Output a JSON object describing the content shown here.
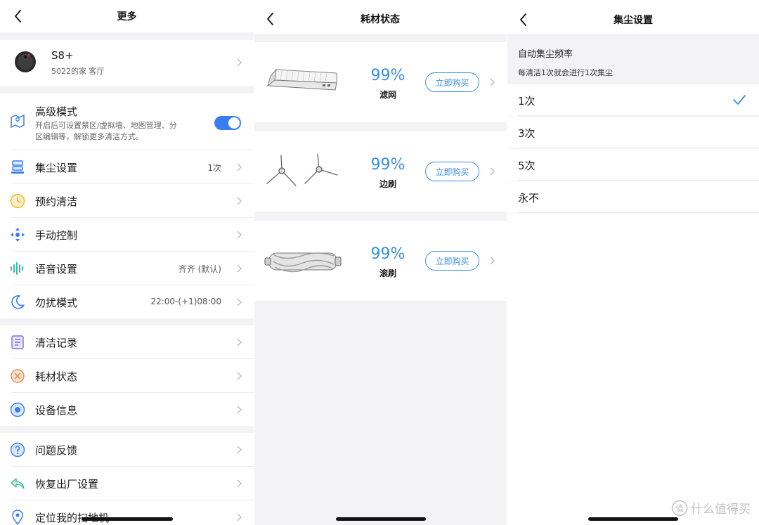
{
  "panel_more": {
    "title": "更多",
    "device": {
      "name": "S8+",
      "location": "5022的家 客厅"
    },
    "advanced_mode": {
      "label": "高级模式",
      "desc_line1": "开启后可设置禁区/虚拟墙、地图管理、分",
      "desc_line2": "区编辑等，解锁更多清洁方式。",
      "enabled": true
    },
    "items": [
      {
        "label": "集尘设置",
        "value": "1次",
        "icon": "dust-station-icon"
      },
      {
        "label": "预约清洁",
        "value": "",
        "icon": "clock-icon"
      },
      {
        "label": "手动控制",
        "value": "",
        "icon": "direction-pad-icon"
      },
      {
        "label": "语音设置",
        "value": "齐齐 (默认)",
        "icon": "sound-wave-icon"
      },
      {
        "label": "勿扰模式",
        "value": "22:00-(+1)08:00",
        "icon": "moon-icon"
      }
    ],
    "items2": [
      {
        "label": "清洁记录",
        "icon": "document-icon"
      },
      {
        "label": "耗材状态",
        "icon": "consumables-icon"
      },
      {
        "label": "设备信息",
        "icon": "device-info-icon"
      }
    ],
    "items3": [
      {
        "label": "问题反馈",
        "icon": "question-icon"
      },
      {
        "label": "恢复出厂设置",
        "icon": "reset-arrow-icon"
      },
      {
        "label": "定位我的扫地机",
        "icon": "location-pin-icon"
      }
    ]
  },
  "panel_consumables": {
    "title": "耗材状态",
    "items": [
      {
        "percent": "99%",
        "name": "滤网",
        "buy_label": "立即购买",
        "icon": "filter-icon"
      },
      {
        "percent": "99%",
        "name": "边刷",
        "buy_label": "立即购买",
        "icon": "side-brush-icon"
      },
      {
        "percent": "99%",
        "name": "滚刷",
        "buy_label": "立即购买",
        "icon": "roller-brush-icon"
      }
    ]
  },
  "panel_dust": {
    "title": "集尘设置",
    "section_title": "自动集尘频率",
    "section_desc": "每清洁1次就会进行1次集尘",
    "options": [
      {
        "label": "1次",
        "selected": true
      },
      {
        "label": "3次",
        "selected": false
      },
      {
        "label": "5次",
        "selected": false
      },
      {
        "label": "永不",
        "selected": false
      }
    ]
  },
  "watermark": "值 什么值得买",
  "colors": {
    "accent": "#3a8fe0",
    "toggle_on": "#3a7df0",
    "background": "#f3f3f5"
  }
}
